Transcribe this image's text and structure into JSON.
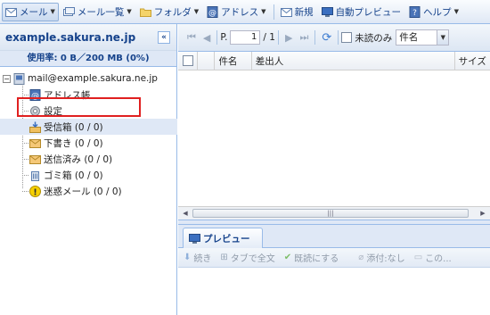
{
  "toolbar": {
    "mail": "メール",
    "mail_list": "メール一覧",
    "folder": "フォルダ",
    "address": "アドレス",
    "new": "新規",
    "auto_preview": "自動プレビュー",
    "help": "ヘルプ"
  },
  "sidebar": {
    "account_title": "example.sakura.ne.jp",
    "usage": "使用率: 0 B／200 MB (0%)",
    "tree": [
      {
        "label": "mail@example.sakura.ne.jp",
        "icon": "mailbox-root-icon"
      },
      {
        "label": "アドレス帳",
        "icon": "address-book-icon"
      },
      {
        "label": "設定",
        "icon": "settings-gear-icon"
      },
      {
        "label": "受信箱 (0 / 0)",
        "icon": "inbox-icon"
      },
      {
        "label": "下書き (0 / 0)",
        "icon": "drafts-icon"
      },
      {
        "label": "送信済み (0 / 0)",
        "icon": "sent-icon"
      },
      {
        "label": "ゴミ箱 (0 / 0)",
        "icon": "trash-icon"
      },
      {
        "label": "迷惑メール (0 / 0)",
        "icon": "spam-warning-icon"
      }
    ]
  },
  "pager": {
    "page_label": "P.",
    "page_value": "1",
    "page_total": "/ 1",
    "unread_only": "未読のみ",
    "search_field": "件名"
  },
  "grid": {
    "columns": [
      "件名",
      "差出人",
      "サイズ"
    ]
  },
  "preview": {
    "tab_label": "プレビュー",
    "actions": [
      "続き",
      "タブで全文",
      "既読にする",
      "添付:なし",
      "この..."
    ]
  },
  "colors": {
    "accent_blue": "#15428b",
    "border_blue": "#99bbe8",
    "highlight_red": "#e02020"
  }
}
